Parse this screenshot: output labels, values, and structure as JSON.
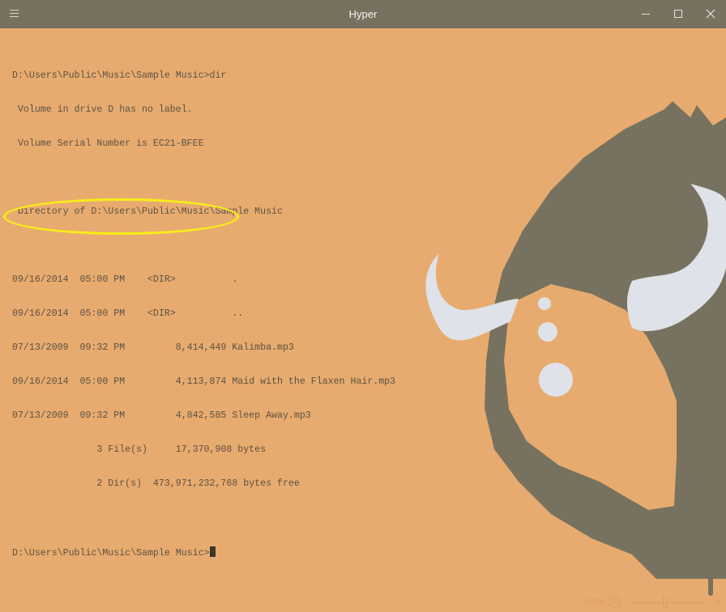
{
  "window": {
    "title": "Hyper"
  },
  "terminal": {
    "lines": [
      "D:\\Users\\Public\\Music\\Sample Music>dir",
      " Volume in drive D has no label.",
      " Volume Serial Number is EC21-BFEE",
      "",
      " Directory of D:\\Users\\Public\\Music\\Sample Music",
      "",
      "09/16/2014  05:00 PM    <DIR>          .",
      "09/16/2014  05:00 PM    <DIR>          ..",
      "07/13/2009  09:32 PM         8,414,449 Kalimba.mp3",
      "09/16/2014  05:00 PM         4,113,874 Maid with the Flaxen Hair.mp3",
      "07/13/2009  09:32 PM         4,842,585 Sleep Away.mp3",
      "               3 File(s)     17,370,908 bytes",
      "               2 Dir(s)  473,971,232,768 bytes free",
      ""
    ],
    "prompt": "D:\\Users\\Public\\Music\\Sample Music>"
  },
  "statusbar": {
    "zoom_label": "100%",
    "zoom_level": 1.0
  },
  "colors": {
    "background": "#e8ab6f",
    "titlebar": "#77725f",
    "text": "#595243",
    "highlight": "#f5ee18",
    "horn": "#dfe2e8",
    "fur": "#77725f"
  },
  "icons": {
    "menu": "hamburger-menu-icon",
    "minimize": "minimize-icon",
    "maximize": "maximize-icon",
    "close": "close-icon",
    "zoom_out": "zoom-out-icon",
    "zoom_in": "zoom-in-icon"
  }
}
